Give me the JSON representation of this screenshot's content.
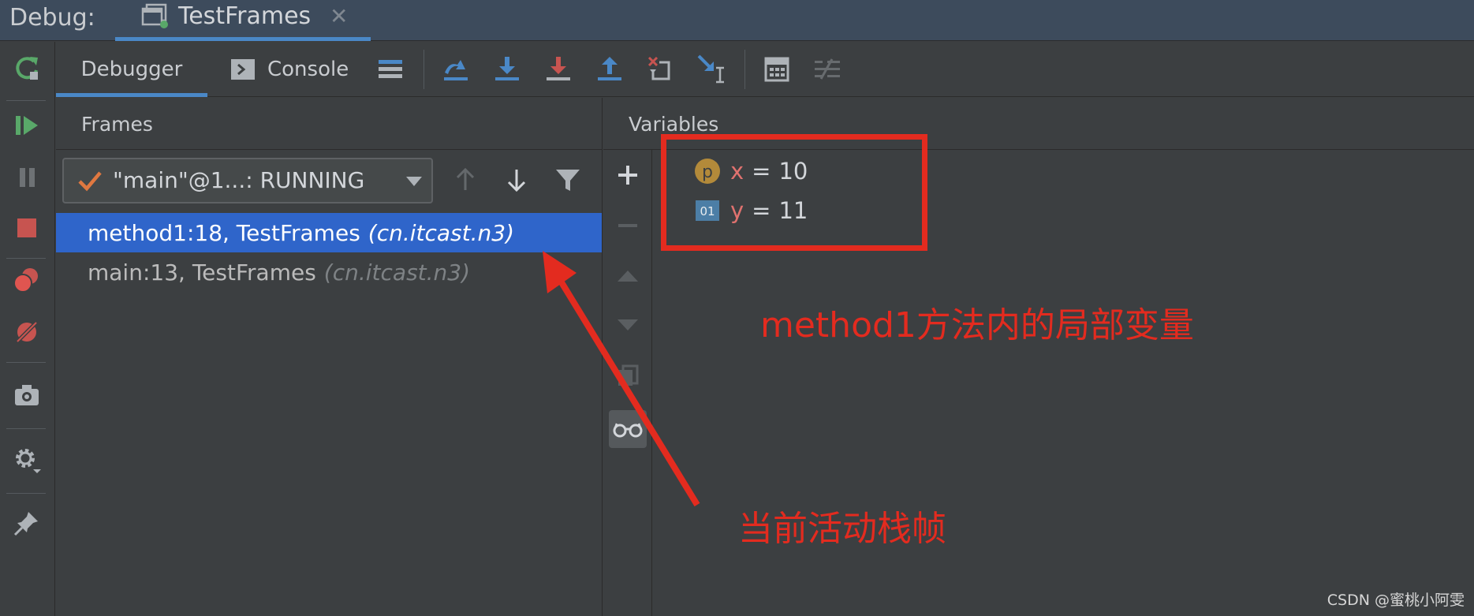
{
  "titlebar": {
    "debug_label": "Debug:",
    "run_tab_title": "TestFrames",
    "close_glyph": "✕"
  },
  "topbar": {
    "tabs": [
      {
        "label": "Debugger",
        "active": true
      },
      {
        "label": "Console",
        "active": false
      }
    ],
    "tools": [
      "layout-icon",
      "show-execution-point-icon",
      "step-over-icon",
      "step-into-icon",
      "force-step-into-icon",
      "step-out-icon",
      "drop-frame-icon",
      "run-to-cursor-icon",
      "evaluate-expression-icon",
      "trace-icon"
    ]
  },
  "left_toolbar": {
    "tools": [
      "rerun-icon",
      "resume-icon",
      "pause-icon",
      "stop-icon",
      "view-breakpoints-icon",
      "mute-breakpoints-icon",
      "camera-icon",
      "settings-icon",
      "pin-icon"
    ]
  },
  "frames": {
    "header": "Frames",
    "thread_selector": "\"main\"@1...: RUNNING",
    "items": [
      {
        "method": "method1:18, TestFrames",
        "package": "(cn.itcast.n3)",
        "selected": true
      },
      {
        "method": "main:13, TestFrames",
        "package": "(cn.itcast.n3)",
        "selected": false
      }
    ]
  },
  "variables": {
    "header": "Variables",
    "items": [
      {
        "badge": "p",
        "name": "x",
        "eq": "=",
        "value": "10"
      },
      {
        "badge": "01",
        "name": "y",
        "eq": "=",
        "value": "11"
      }
    ]
  },
  "annotations": {
    "vars_note": "method1方法内的局部变量",
    "frame_note": "当前活动栈帧",
    "color": "#e32b1f"
  },
  "watermark": "CSDN @蜜桃小阿雯",
  "colors": {
    "selection": "#2f65ca",
    "accent": "#4a88c7",
    "background": "#3c3f41"
  }
}
